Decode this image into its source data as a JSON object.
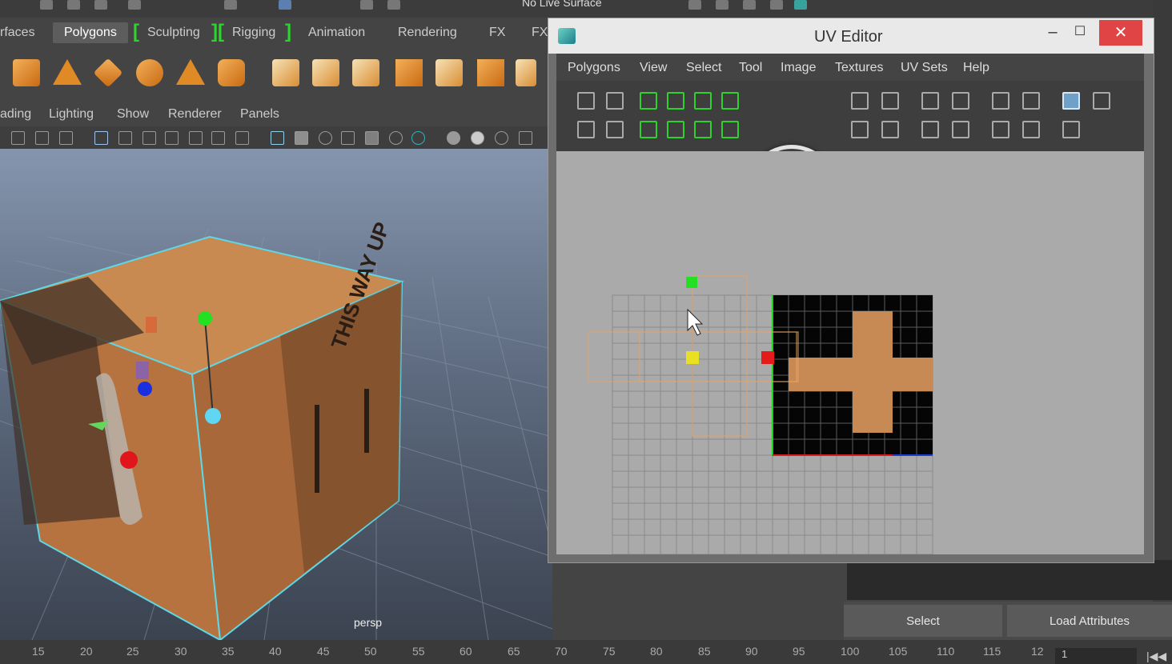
{
  "status": {
    "live_surface": "No Live Surface"
  },
  "shelf_tabs": [
    {
      "label": "rfaces",
      "active": false
    },
    {
      "label": "Polygons",
      "active": true
    },
    {
      "label": "Sculpting",
      "active": false
    },
    {
      "label": "Rigging",
      "active": false
    },
    {
      "label": "Animation",
      "active": false
    },
    {
      "label": "Rendering",
      "active": false
    },
    {
      "label": "FX",
      "active": false
    },
    {
      "label": "FX",
      "active": false
    }
  ],
  "shelf_icons": [
    "cylinder-icon",
    "cone-icon",
    "plane-icon",
    "torus-icon",
    "pyramid-icon",
    "pipe-icon",
    "combine-icon",
    "separate-icon",
    "extract-icon",
    "grid-icon",
    "cube-icon",
    "mesh-icon",
    "pencil-icon"
  ],
  "panel_menu": [
    "ading",
    "Lighting",
    "Show",
    "Renderer",
    "Panels"
  ],
  "viewport": {
    "camera_label": "persp"
  },
  "uv_editor": {
    "title": "UV Editor",
    "menus": [
      "Polygons",
      "View",
      "Select",
      "Tool",
      "Image",
      "Textures",
      "UV Sets",
      "Help"
    ],
    "accent": "#2fd12f",
    "close_color": "#e04444"
  },
  "bottom_buttons": {
    "select": "Select",
    "load_attributes": "Load Attributes"
  },
  "timeline": {
    "ticks": [
      "15",
      "20",
      "25",
      "30",
      "35",
      "40",
      "45",
      "50",
      "55",
      "60",
      "65",
      "70",
      "75",
      "80",
      "85",
      "90",
      "95",
      "100",
      "105",
      "110",
      "115",
      "12"
    ],
    "current_frame": "1"
  }
}
